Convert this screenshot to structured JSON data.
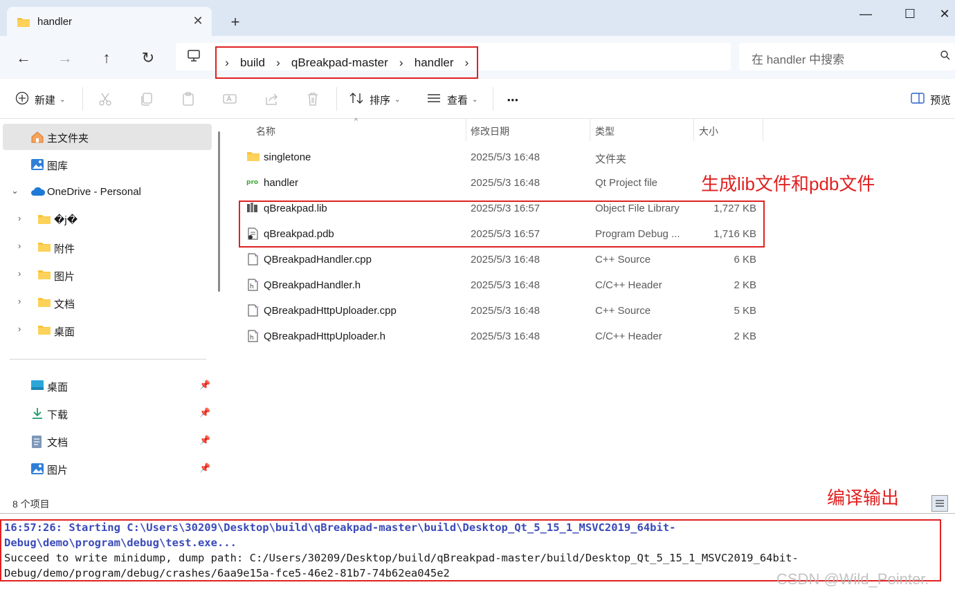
{
  "window": {
    "tab_title": "handler",
    "new_tab": "+",
    "minimize": "—",
    "maximize": "☐",
    "close": "✕"
  },
  "nav": {
    "breadcrumb": [
      "build",
      "qBreakpad-master",
      "handler"
    ],
    "search_placeholder": "在 handler 中搜索"
  },
  "toolbar": {
    "new_label": "新建",
    "sort_label": "排序",
    "view_label": "查看",
    "more_label": "•••",
    "preview_label": "预览"
  },
  "sidebar": {
    "home": "主文件夹",
    "gallery": "图库",
    "onedrive": "OneDrive - Personal",
    "onedrive_children": [
      "�j�",
      "附件",
      "图片",
      "文档",
      "桌面"
    ],
    "quick_access": [
      "桌面",
      "下载",
      "文档",
      "图片"
    ]
  },
  "columns": {
    "name": "名称",
    "date": "修改日期",
    "type": "类型",
    "size": "大小"
  },
  "files": [
    {
      "name": "singletone",
      "date": "2025/5/3 16:48",
      "type": "文件夹",
      "size": "",
      "icon": "folder-icon"
    },
    {
      "name": "handler",
      "date": "2025/5/3 16:48",
      "type": "Qt Project file",
      "size": "",
      "icon": "qt-project-icon"
    },
    {
      "name": "qBreakpad.lib",
      "date": "2025/5/3 16:57",
      "type": "Object File Library",
      "size": "1,727 KB",
      "icon": "library-icon"
    },
    {
      "name": "qBreakpad.pdb",
      "date": "2025/5/3 16:57",
      "type": "Program Debug ...",
      "size": "1,716 KB",
      "icon": "pdb-icon"
    },
    {
      "name": "QBreakpadHandler.cpp",
      "date": "2025/5/3 16:48",
      "type": "C++ Source",
      "size": "6 KB",
      "icon": "cpp-file-icon"
    },
    {
      "name": "QBreakpadHandler.h",
      "date": "2025/5/3 16:48",
      "type": "C/C++ Header",
      "size": "2 KB",
      "icon": "header-file-icon"
    },
    {
      "name": "QBreakpadHttpUploader.cpp",
      "date": "2025/5/3 16:48",
      "type": "C++ Source",
      "size": "5 KB",
      "icon": "cpp-file-icon"
    },
    {
      "name": "QBreakpadHttpUploader.h",
      "date": "2025/5/3 16:48",
      "type": "C/C++ Header",
      "size": "2 KB",
      "icon": "header-file-icon"
    }
  ],
  "annotations": {
    "lib_pdb": "生成lib文件和pdb文件",
    "output": "编译输出"
  },
  "status": {
    "count": "8 个项目"
  },
  "console": {
    "line1": "16:57:26: Starting C:\\Users\\30209\\Desktop\\build\\qBreakpad-master\\build\\Desktop_Qt_5_15_1_MSVC2019_64bit-Debug\\demo\\program\\debug\\test.exe...",
    "line2": "Succeed to write minidump, dump path: C:/Users/30209/Desktop/build/qBreakpad-master/build/Desktop_Qt_5_15_1_MSVC2019_64bit-Debug/demo/program/debug/crashes/6aa9e15a-fce5-46e2-81b7-74b62ea045e2"
  },
  "watermark": "CSDN @Wild_Pointer.",
  "colors": {
    "accent": "#e02020",
    "titlebar": "#dde7f4",
    "console_blue": "#3a4ab8"
  }
}
